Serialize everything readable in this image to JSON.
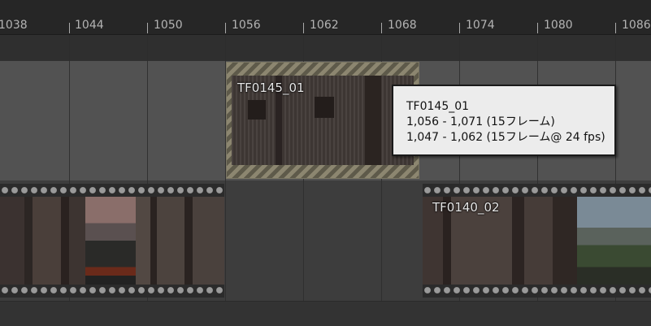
{
  "ruler": {
    "ticks": [
      "1038",
      "1044",
      "1050",
      "1056",
      "1062",
      "1068",
      "1074",
      "1080",
      "1086"
    ]
  },
  "clips": {
    "selected": {
      "name": "TF0145_01"
    },
    "left": {
      "name": ""
    },
    "right": {
      "name": "TF0140_02"
    }
  },
  "tooltip": {
    "name": "TF0145_01",
    "range": "1,056 - 1,071 (15フレーム)",
    "source_range": "1,047 - 1,062 (15フレーム@ 24 fps)"
  }
}
